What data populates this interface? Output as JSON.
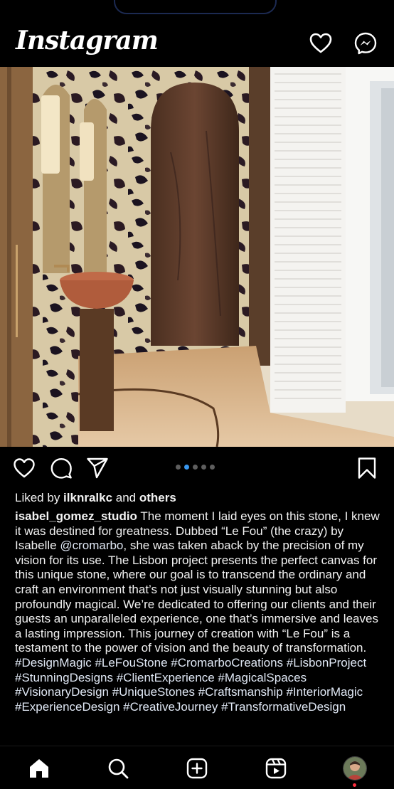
{
  "header": {
    "logo_text": "Instagram",
    "icons": [
      "heart-icon",
      "messenger-icon"
    ]
  },
  "post": {
    "image_description_icon": "photo",
    "carousel": {
      "count": 5,
      "active_index": 1
    },
    "actions": [
      "like-icon",
      "comment-icon",
      "share-icon",
      "save-icon"
    ],
    "likes": {
      "prefix": "Liked by ",
      "user": "ilknralkc",
      "middle": " and ",
      "others": "others"
    },
    "caption": {
      "username": "isabel_gomez_studio",
      "text_1": " The moment I laid eyes on this stone, I knew it was destined for greatness. Dubbed “Le Fou” (the crazy) by Isabelle ",
      "mention": "@cromarbo",
      "text_2": ", she was taken aback by the precision of my vision for its use. The Lisbon project presents the perfect canvas for this unique stone, where our goal is to transcend the ordinary and craft an environment that’s not just visually stunning but also profoundly magical. We’re dedicated to offering our clients and their guests an unparalleled experience, one that’s immersive and leaves a lasting impression. This journey of creation with “Le Fou” is a testament to the power of vision and the beauty of transformation. ",
      "hashtags": "#DesignMagic #LeFouStone #CromarboCreations #LisbonProject #StunningDesigns #ClientExperience #MagicalSpaces #VisionaryDesign #UniqueStones #Craftsmanship #InteriorMagic #ExperienceDesign #CreativeJourney #TransformativeDesign"
    }
  },
  "bottom_nav": {
    "items": [
      "home-icon",
      "search-icon",
      "create-icon",
      "reels-icon",
      "profile-avatar"
    ]
  },
  "colors": {
    "background": "#000000",
    "carousel_active": "#3897f0",
    "notification": "#ff3040"
  }
}
